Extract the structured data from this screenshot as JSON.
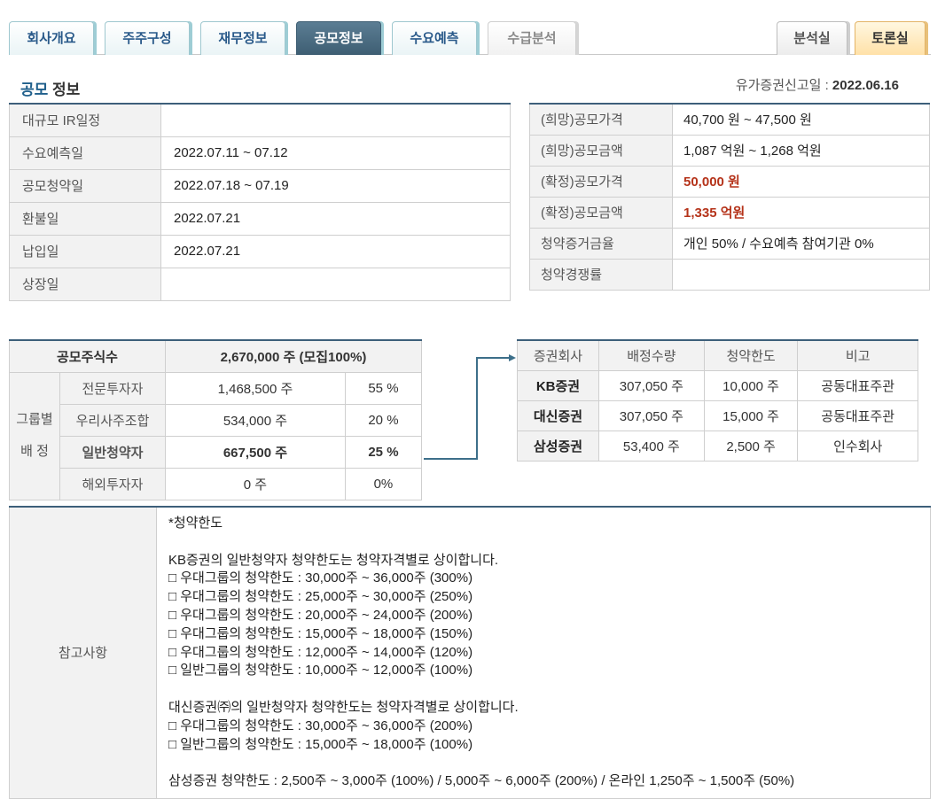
{
  "tabs": {
    "left": [
      "회사개요",
      "주주구성",
      "재무정보",
      "공모정보",
      "수요예측",
      "수급분석"
    ],
    "right": [
      "분석실",
      "토론실"
    ]
  },
  "section": {
    "title_accent": "공모",
    "title_rest": " 정보"
  },
  "filing": {
    "label": "유가증권신고일 : ",
    "date": "2022.06.16"
  },
  "schedule": [
    {
      "label": "대규모 IR일정",
      "value": ""
    },
    {
      "label": "수요예측일",
      "value": "2022.07.11 ~ 07.12"
    },
    {
      "label": "공모청약일",
      "value": "2022.07.18 ~ 07.19"
    },
    {
      "label": "환불일",
      "value": "2022.07.21"
    },
    {
      "label": "납입일",
      "value": "2022.07.21"
    },
    {
      "label": "상장일",
      "value": ""
    }
  ],
  "pricing": [
    {
      "label": "(희망)공모가격",
      "value": "40,700 원 ~ 47,500 원"
    },
    {
      "label": "(희망)공모금액",
      "value": "1,087 억원  ~ 1,268 억원"
    },
    {
      "label": "(확정)공모가격",
      "value": "50,000 원"
    },
    {
      "label": "(확정)공모금액",
      "value": "1,335 억원"
    },
    {
      "label": "청약증거금율",
      "value": "개인 50% / 수요예측 참여기관 0%"
    },
    {
      "label": "청약경쟁률",
      "value": ""
    }
  ],
  "allocation": {
    "total_label": "공모주식수",
    "total_value": "2,670,000 주 (모집100%)",
    "group_label_1": "그룹별",
    "group_label_2": "배 정",
    "rows": [
      {
        "category": "전문투자자",
        "shares": "1,468,500 주",
        "pct": "55 %"
      },
      {
        "category": "우리사주조합",
        "shares": "534,000 주",
        "pct": "20 %"
      },
      {
        "category": "일반청약자",
        "shares": "667,500 주",
        "pct": "25 %"
      },
      {
        "category": "해외투자자",
        "shares": "0 주",
        "pct": "0%"
      }
    ]
  },
  "brokers": {
    "headers": [
      "증권회사",
      "배정수량",
      "청약한도",
      "비고"
    ],
    "rows": [
      {
        "name": "KB증권",
        "qty": "307,050 주",
        "limit": "10,000 주",
        "note": "공동대표주관"
      },
      {
        "name": "대신증권",
        "qty": "307,050 주",
        "limit": "15,000 주",
        "note": "공동대표주관"
      },
      {
        "name": "삼성증권",
        "qty": "53,400 주",
        "limit": "2,500 주",
        "note": "인수회사"
      }
    ]
  },
  "notes": {
    "label": "참고사항",
    "lines": [
      "*청약한도",
      "",
      "KB증권의 일반청약자 청약한도는 청약자격별로 상이합니다.",
      "□ 우대그룹의 청약한도 : 30,000주 ~ 36,000주 (300%)",
      "□ 우대그룹의 청약한도 : 25,000주 ~ 30,000주 (250%)",
      "□ 우대그룹의 청약한도 : 20,000주 ~ 24,000주 (200%)",
      "□ 우대그룹의 청약한도 : 15,000주 ~ 18,000주 (150%)",
      "□ 우대그룹의 청약한도 : 12,000주 ~ 14,000주 (120%)",
      "□ 일반그룹의 청약한도 : 10,000주 ~ 12,000주 (100%)",
      "",
      "대신증권㈜의 일반청약자 청약한도는 청약자격별로 상이합니다.",
      "□ 우대그룹의 청약한도 : 30,000주 ~ 36,000주 (200%)",
      "□ 일반그룹의 청약한도 : 15,000주 ~ 18,000주 (100%)",
      "",
      "삼성증권 청약한도 : 2,500주 ~ 3,000주 (100%) / 5,000주 ~ 6,000주 (200%) / 온라인 1,250주 ~ 1,500주 (50%)"
    ]
  }
}
